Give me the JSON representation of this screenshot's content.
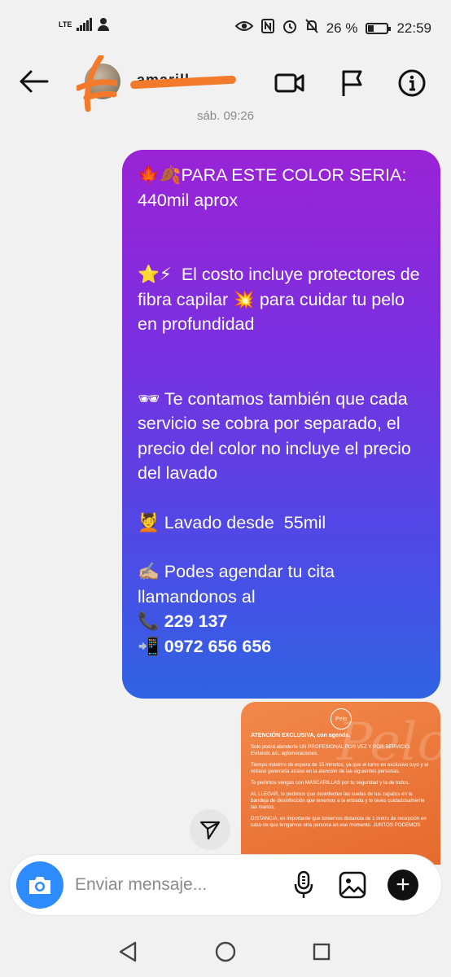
{
  "status_bar": {
    "network": "LTE",
    "battery": "26 %",
    "battery_level": 0.26,
    "time": "22:59"
  },
  "header": {
    "username": "amarill...",
    "icons": [
      "back-arrow-icon",
      "video-call-icon",
      "flag-icon",
      "info-icon"
    ]
  },
  "timestamp": "sáb. 09:26",
  "message": {
    "p1": "🍁🍂PARA ESTE COLOR SERIA: 440mil aprox",
    "p2": "⭐⚡  El costo incluye protectores de fibra capilar 💥 para cuidar tu pelo en profundidad",
    "p3": "🕶 Te contamos también que cada servicio se cobra por separado, el precio del color no incluye el precio del lavado",
    "p4": "💆 Lavado desde  55mil",
    "p5": "✍🏼 Podes agendar tu cita llamandonos al",
    "phone1": "📞 229 137",
    "phone2": "📲 0972 656 656"
  },
  "image_message": {
    "logo": "Pelo",
    "title": "ATENCIÓN EXCLUSIVA, con agenda.",
    "line1": "Solo podrá atenderte UN PROFESIONAL POR VEZ Y POR SERVICIO. Evitando así, aglomeraciones.",
    "line2": "Tiempo máximo de espera de 15 minutos, ya que el turno es exclusivo tuyo y el retraso generaría atraso en la atención de las siguientes personas.",
    "line3": "Te pedimos vengas con MASCARILLAS por tu seguridad y la de todos.",
    "line4": "AL LLEGAR, te pedimos que desinfectes las suelas de tus zapatos en la bandeja de desinfección que tenemos a la entrada y te laves cuidadosamente las manos.",
    "line5": "DISTANCIA, es importante que tomemos distancia de 1 metro de recepción en caso de que tengamos otra persona en ese momento. JUNTOS PODEMOS"
  },
  "composer": {
    "placeholder": "Enviar mensaje..."
  },
  "colors": {
    "bubble_top": "#9a23d6",
    "bubble_bottom": "#2f63e3",
    "camera": "#2f8cff",
    "image_bg": "#e56a2d"
  }
}
